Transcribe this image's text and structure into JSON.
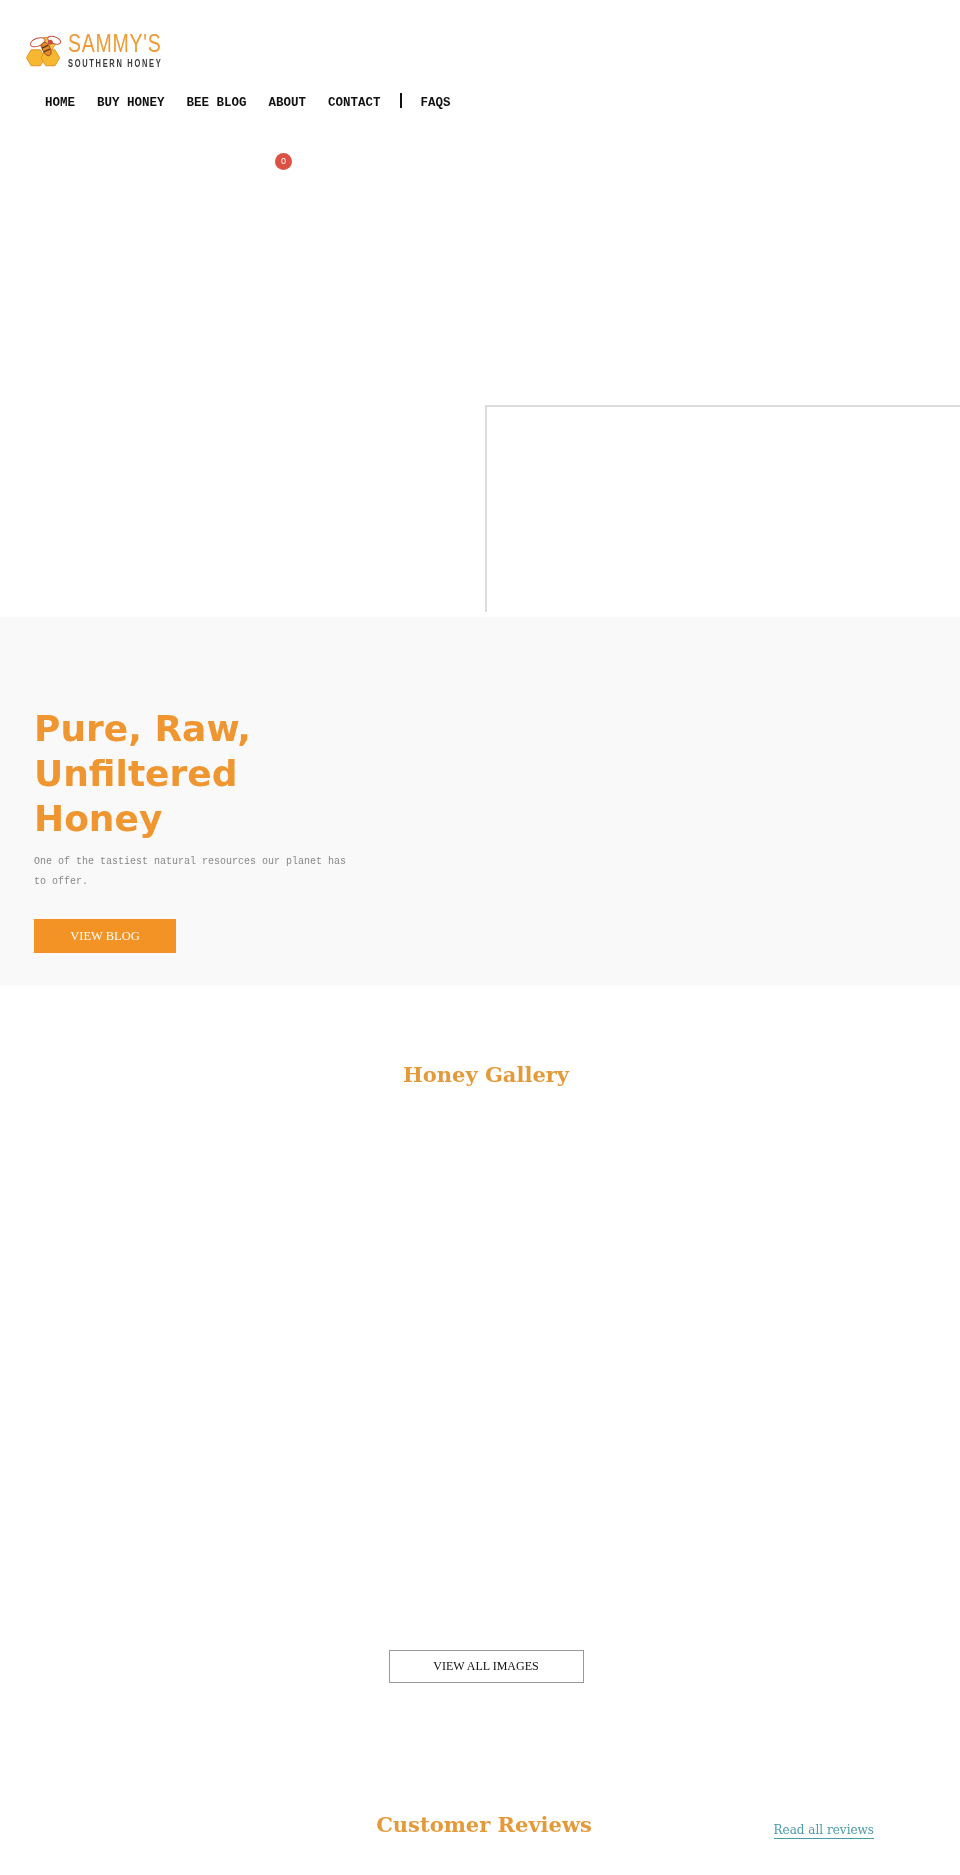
{
  "header": {
    "logo": {
      "name": "SAMMY'S",
      "tagline": "SOUTHERN HONEY"
    },
    "nav": [
      {
        "kind": "link",
        "label": "HOME"
      },
      {
        "kind": "link",
        "label": "BUY HONEY"
      },
      {
        "kind": "link",
        "label": "BEE BLOG"
      },
      {
        "kind": "link",
        "label": "ABOUT"
      },
      {
        "kind": "link",
        "label": "CONTACT"
      },
      {
        "kind": "divider"
      },
      {
        "kind": "link",
        "label": "FAQS"
      }
    ],
    "cart_count": "0"
  },
  "hero": {
    "title": "Pure, Raw, Unfiltered Honey",
    "text": "One of the tastiest natural resources our planet has to offer.",
    "button": "VIEW BLOG"
  },
  "gallery": {
    "title": "Honey Gallery",
    "button": "VIEW ALL IMAGES"
  },
  "reviews": {
    "title": "Customer Reviews",
    "link": "Read all reviews"
  }
}
